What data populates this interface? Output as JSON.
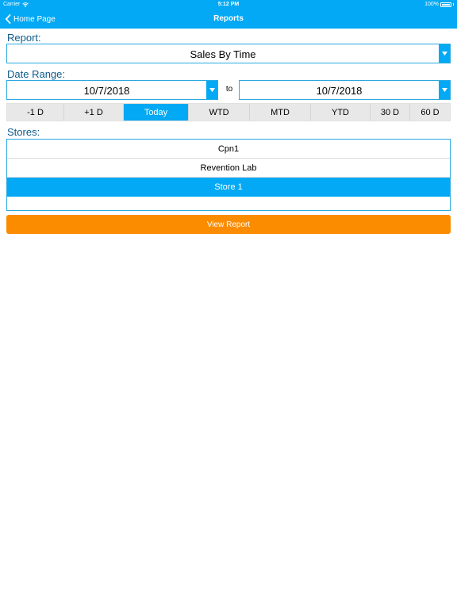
{
  "status_bar": {
    "carrier": "Carrier",
    "time": "5:12 PM",
    "battery": "100%"
  },
  "nav": {
    "back_label": "Home Page",
    "title": "Reports"
  },
  "report": {
    "label": "Report:",
    "selected": "Sales By Time"
  },
  "date_range": {
    "label": "Date Range:",
    "start": "10/7/2018",
    "separator": "to",
    "end": "10/7/2018"
  },
  "quick_ranges": [
    {
      "label": "-1 D",
      "active": false
    },
    {
      "label": "+1 D",
      "active": false
    },
    {
      "label": "Today",
      "active": true
    },
    {
      "label": "WTD",
      "active": false
    },
    {
      "label": "MTD",
      "active": false
    },
    {
      "label": "YTD",
      "active": false
    },
    {
      "label": "30 D",
      "active": false
    },
    {
      "label": "60 D",
      "active": false
    }
  ],
  "stores": {
    "label": "Stores:",
    "items": [
      {
        "name": "Cpn1",
        "selected": false
      },
      {
        "name": "Revention Lab",
        "selected": false
      },
      {
        "name": "Store 1",
        "selected": true
      }
    ]
  },
  "actions": {
    "view_report_label": "View Report"
  },
  "colors": {
    "accent": "#03a9f4",
    "label_text": "#0d5a8a",
    "action": "#fb8c00"
  }
}
